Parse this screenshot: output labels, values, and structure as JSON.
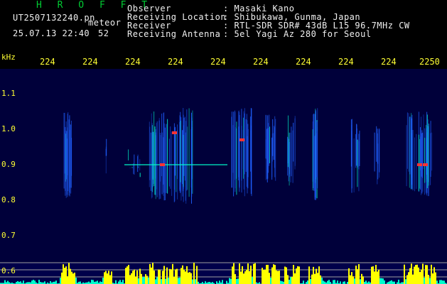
{
  "header": {
    "title": "H R O F F T",
    "filename": "UT2507132240.pn",
    "kind": "meteor",
    "datetime": "25.07.13 22:40",
    "count": "52",
    "fields": [
      {
        "label": "Observer",
        "value": ": Masaki Kano"
      },
      {
        "label": "Receiving Location",
        "value": ": Shibukawa, Gunma, Japan"
      },
      {
        "label": "Receiver",
        "value": ": RTL-SDR SDR# 43dB L15 96.7MHz CW"
      },
      {
        "label": "Receiving Antenna",
        "value": ": 5el Yagi Az 280 for Seoul"
      }
    ]
  },
  "axis": {
    "unit": "kHz",
    "y_ticks": [
      "1.1",
      "1.0",
      "0.9",
      "0.8",
      "0.7",
      "0.6"
    ],
    "x_ticks": [
      "224",
      "224",
      "224",
      "224",
      "224",
      "224",
      "224",
      "224",
      "224",
      "2250"
    ]
  },
  "colors": {
    "background": "#000000",
    "plot": "#00003a",
    "text": "#ffff33",
    "title": "#00cc33",
    "signal_low": "#2060ff",
    "signal_mid": "#00ffcc",
    "signal_high": "#ff3333",
    "histogram": "#ffff00"
  }
}
